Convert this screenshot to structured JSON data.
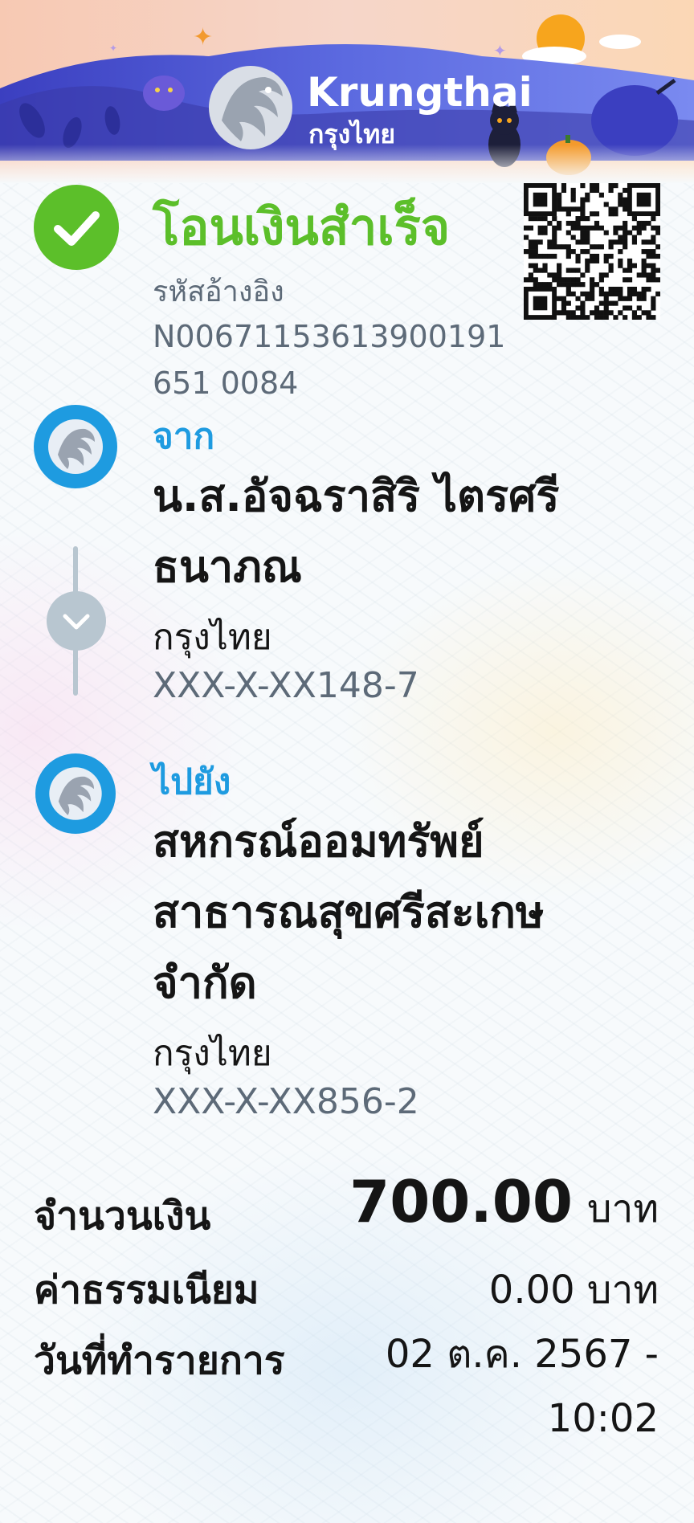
{
  "banner": {
    "brand_en": "Krungthai",
    "brand_th": "กรุงไทย"
  },
  "status": {
    "title": "โอนเงินสำเร็จ",
    "ref_label": "รหัสอ้างอิง",
    "ref_value": "N00671153613900191651 0084",
    "icon": "check-icon",
    "color": "#5cbf2a"
  },
  "from": {
    "label": "จาก",
    "name": "น.ส.อัจฉราสิริ ไตรศรีธนาภณ",
    "bank": "กรุงไทย",
    "account": "XXX-X-XX148-7"
  },
  "to": {
    "label": "ไปยัง",
    "name": "สหกรณ์ออมทรัพย์สาธารณสุขศรีสะเกษ จำกัด",
    "bank": "กรุงไทย",
    "account": "XXX-X-XX856-2"
  },
  "summary": {
    "amount_label": "จำนวนเงิน",
    "amount_value": "700.00",
    "amount_unit": "บาท",
    "fee_label": "ค่าธรรมเนียม",
    "fee_value": "0.00 บาท",
    "date_label": "วันที่ทำรายการ",
    "date_value": "02 ต.ค. 2567 -",
    "time_value": "10:02"
  },
  "colors": {
    "accent_blue": "#1e9be0",
    "success_green": "#5cbf2a",
    "muted_text": "#5d6a78",
    "banner_purple": "#4a4fc8"
  }
}
